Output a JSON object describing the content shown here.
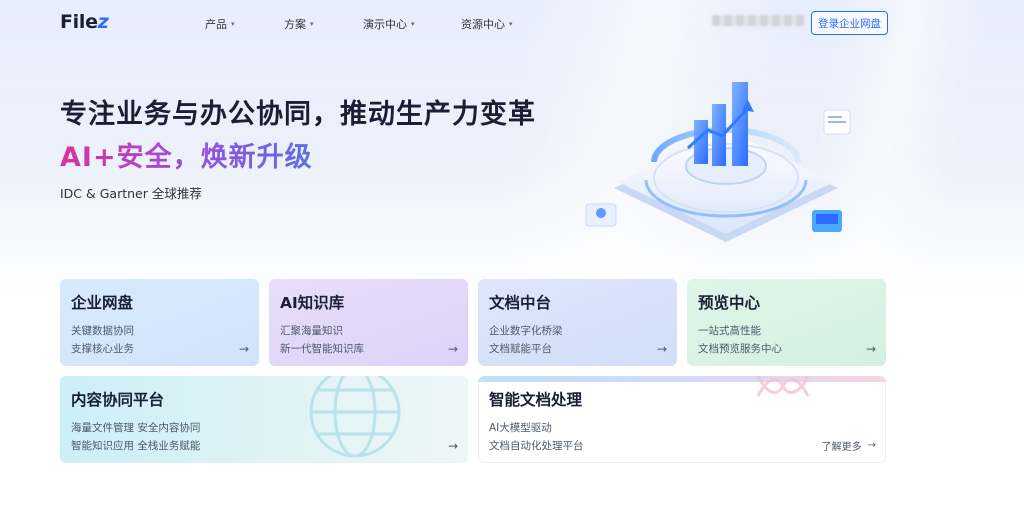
{
  "nav": {
    "logo_main": "File",
    "logo_accent": "z",
    "items": [
      {
        "label": "产品"
      },
      {
        "label": "方案"
      },
      {
        "label": "演示中心"
      },
      {
        "label": "资源中心"
      }
    ],
    "login_label": "登录企业网盘"
  },
  "hero": {
    "headline": "专注业务与办公协同，推动生产力变革",
    "headline2": "AI+安全，焕新升级",
    "subtitle": "IDC & Gartner 全球推荐"
  },
  "cards": [
    {
      "title": "企业网盘",
      "lines": [
        "关键数据协同",
        "支撑核心业务"
      ]
    },
    {
      "title": "AI知识库",
      "lines": [
        "汇聚海量知识",
        "新一代智能知识库"
      ]
    },
    {
      "title": "文档中台",
      "lines": [
        "企业数字化桥梁",
        "文档赋能平台"
      ]
    },
    {
      "title": "预览中心",
      "lines": [
        "一站式高性能",
        "文档预览服务中心"
      ]
    },
    {
      "title": "内容协同平台",
      "lines": [
        "海量文件管理 安全内容协同",
        "智能知识应用 全栈业务赋能"
      ]
    },
    {
      "title": "智能文档处理",
      "lines": [
        "AI大模型驱动",
        "文档自动化处理平台"
      ],
      "more": "了解更多"
    }
  ],
  "icons": {
    "arrow": "→",
    "caret": "▾"
  },
  "colors": {
    "accent": "#2b6cff",
    "gradient_pink": "#d8339b",
    "gradient_blue": "#5a6fe8"
  }
}
